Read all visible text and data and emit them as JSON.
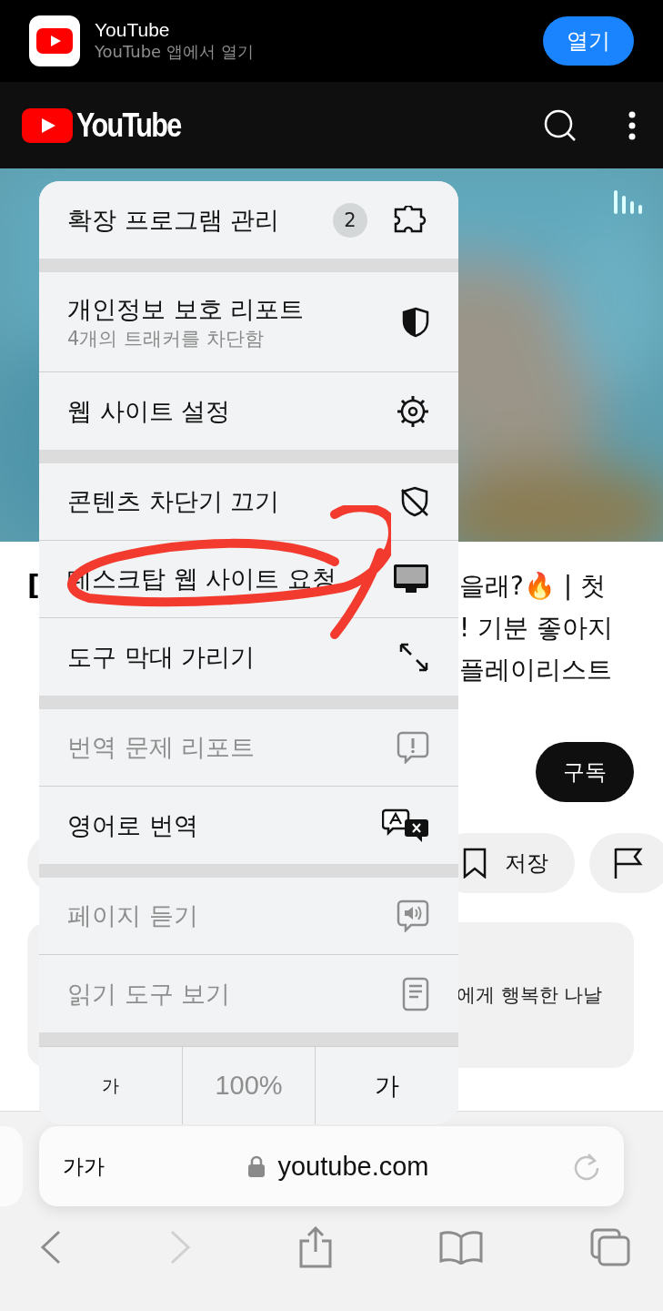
{
  "app_banner": {
    "title": "YouTube",
    "subtitle": "YouTube 앱에서 열기",
    "button": "열기"
  },
  "header": {
    "logo_text": "YouTube"
  },
  "video_title": {
    "fragment_left": "[",
    "lines": [
      "을래?🔥 | 첫",
      "! 기분 좋아지",
      "플레이리스트"
    ]
  },
  "subscribe_button": "구독",
  "save_button": "저장",
  "card": {
    "text": "에게 행복한 나날"
  },
  "menu": {
    "groups": [
      [
        {
          "label": "확장 프로그램 관리",
          "badge": "2",
          "disabled": false
        }
      ],
      [
        {
          "label": "개인정보 보호 리포트",
          "subtitle": "4개의 트래커를 차단함",
          "disabled": false
        },
        {
          "label": "웹 사이트 설정",
          "disabled": false
        }
      ],
      [
        {
          "label": "콘텐츠 차단기 끄기",
          "disabled": false
        },
        {
          "label": "데스크탑 웹 사이트 요청",
          "disabled": false
        },
        {
          "label": "도구 막대 가리기",
          "disabled": false
        }
      ],
      [
        {
          "label": "번역 문제 리포트",
          "disabled": true
        },
        {
          "label": "영어로 번역",
          "disabled": false
        }
      ],
      [
        {
          "label": "페이지 듣기",
          "disabled": true
        },
        {
          "label": "읽기 도구 보기",
          "disabled": true
        }
      ]
    ],
    "text_size": {
      "smaller": "가",
      "zoom": "100%",
      "larger": "가"
    }
  },
  "address_bar": {
    "text_button": "가가",
    "url": "youtube.com"
  }
}
